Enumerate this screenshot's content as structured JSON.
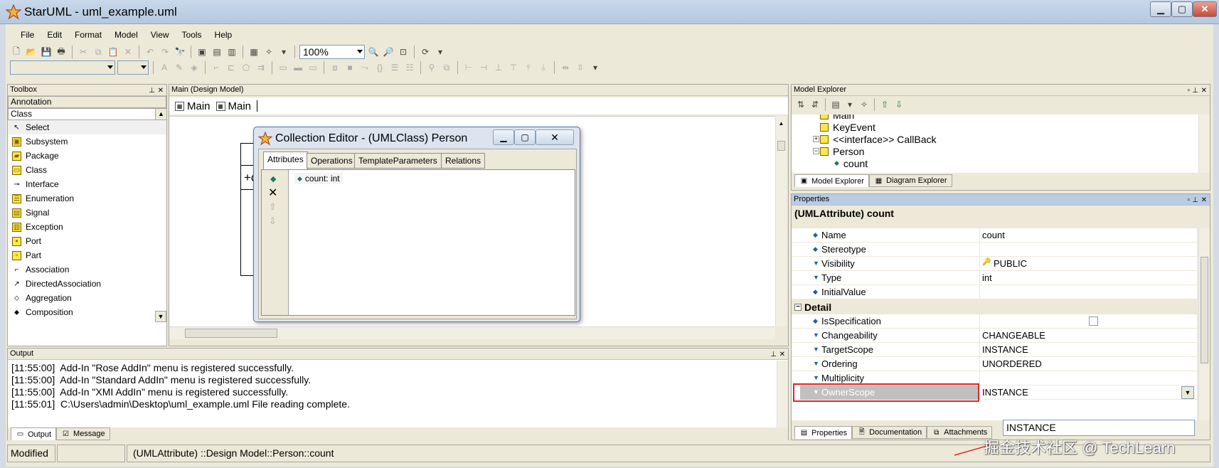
{
  "window": {
    "title": "StarUML - uml_example.uml",
    "minimize": "▁",
    "maximize": "▢",
    "close": "✕"
  },
  "menu": [
    "File",
    "Edit",
    "Format",
    "Model",
    "View",
    "Tools",
    "Help"
  ],
  "toolbar": {
    "zoom": "100%"
  },
  "toolbox": {
    "title": "Toolbox",
    "categories": [
      "Annotation",
      "Class"
    ],
    "items": [
      {
        "label": "Select",
        "icon": "cursor-icon"
      },
      {
        "label": "Subsystem",
        "icon": "subsystem-icon"
      },
      {
        "label": "Package",
        "icon": "package-icon"
      },
      {
        "label": "Class",
        "icon": "class-icon"
      },
      {
        "label": "Interface",
        "icon": "interface-icon"
      },
      {
        "label": "Enumeration",
        "icon": "enumeration-icon"
      },
      {
        "label": "Signal",
        "icon": "signal-icon"
      },
      {
        "label": "Exception",
        "icon": "exception-icon"
      },
      {
        "label": "Port",
        "icon": "port-icon"
      },
      {
        "label": "Part",
        "icon": "part-icon"
      },
      {
        "label": "Association",
        "icon": "association-icon"
      },
      {
        "label": "DirectedAssociation",
        "icon": "directed-association-icon"
      },
      {
        "label": "Aggregation",
        "icon": "aggregation-icon"
      },
      {
        "label": "Composition",
        "icon": "composition-icon"
      }
    ]
  },
  "diagram": {
    "title": "Main (Design Model)",
    "tabs": [
      "Main",
      "Main"
    ],
    "class_attr": "+cou"
  },
  "explorer": {
    "title": "Model Explorer",
    "tree": [
      {
        "label": "Main",
        "indent": 0
      },
      {
        "label": "KeyEvent",
        "indent": 0
      },
      {
        "label": "<<interface>> CallBack",
        "indent": 0,
        "expand": "+"
      },
      {
        "label": "Person",
        "indent": 0,
        "expand": "-"
      },
      {
        "label": "count",
        "indent": 1
      }
    ],
    "tabs": [
      "Model Explorer",
      "Diagram Explorer"
    ]
  },
  "properties": {
    "title": "Properties",
    "header": "(UMLAttribute) count",
    "detail_label": "Detail",
    "rows": [
      {
        "name": "Name",
        "value": "count"
      },
      {
        "name": "Stereotype",
        "value": ""
      },
      {
        "name": "Visibility",
        "value": "PUBLIC"
      },
      {
        "name": "Type",
        "value": "int"
      },
      {
        "name": "InitialValue",
        "value": ""
      }
    ],
    "detail_rows": [
      {
        "name": "IsSpecification",
        "value": ""
      },
      {
        "name": "Changeability",
        "value": "CHANGEABLE"
      },
      {
        "name": "TargetScope",
        "value": "INSTANCE"
      },
      {
        "name": "Ordering",
        "value": "UNORDERED"
      },
      {
        "name": "Multiplicity",
        "value": ""
      },
      {
        "name": "OwnerScope",
        "value": "INSTANCE"
      }
    ],
    "dropdown_option": "INSTANCE",
    "tabs": [
      "Properties",
      "Documentation",
      "Attachments"
    ]
  },
  "output": {
    "title": "Output",
    "lines": [
      "[11:55:00]  Add-In \"Rose AddIn\" menu is registered successfully.",
      "[11:55:00]  Add-In \"Standard AddIn\" menu is registered successfully.",
      "[11:55:00]  Add-In \"XMI AddIn\" menu is registered successfully.",
      "[11:55:01]  C:\\Users\\admin\\Desktop\\uml_example.uml File reading complete."
    ],
    "tabs": [
      "Output",
      "Message"
    ]
  },
  "statusbar": {
    "state": "Modified",
    "path": "(UMLAttribute) ::Design Model::Person::count"
  },
  "dialog": {
    "title": "Collection Editor - (UMLClass) Person",
    "tabs": [
      "Attributes",
      "Operations",
      "TemplateParameters",
      "Relations"
    ],
    "items": [
      "count: int"
    ]
  },
  "watermark": "掘金技术社区 @ TechLearn",
  "colors": {
    "highlight_border": "#e0282a",
    "selected_row": "#c0c0c0",
    "title_bar": "#b9cce4"
  }
}
